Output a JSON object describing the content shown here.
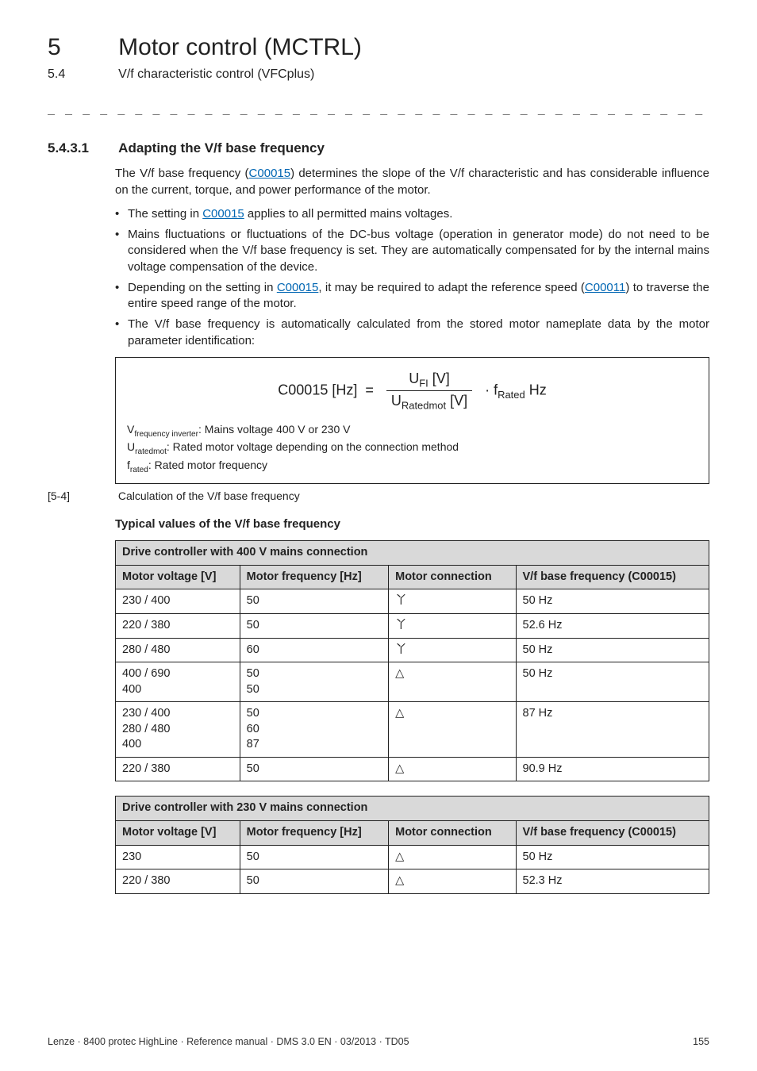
{
  "header": {
    "chapter_num": "5",
    "chapter_title": "Motor control (MCTRL)",
    "section_num": "5.4",
    "section_title": "V/f characteristic control (VFCplus)"
  },
  "dashline": "_ _ _ _ _ _ _ _ _ _ _ _ _ _ _ _ _ _ _ _ _ _ _ _ _ _ _ _ _ _ _ _ _ _ _ _ _ _ _ _ _ _ _ _ _ _ _ _ _ _ _ _ _ _ _ _ _ _ _ _ _ _ _ _",
  "h3": {
    "num": "5.4.3.1",
    "title": "Adapting the V/f base frequency"
  },
  "intro": {
    "pre": "The V/f base frequency (",
    "link1": "C00015",
    "post": ") determines the slope of the V/f characteristic and has considerable influence on the current, torque, and power performance of the motor."
  },
  "bullets": {
    "b1_pre": "The setting in ",
    "b1_link": "C00015",
    "b1_post": " applies to all permitted mains voltages.",
    "b2": "Mains fluctuations or fluctuations of the DC-bus voltage (operation in generator mode) do not need to be considered when the V/f base frequency is set. They are automatically compensated for by the internal mains voltage compensation of the device.",
    "b3_pre": "Depending on the setting in ",
    "b3_link1": "C00015",
    "b3_mid": ", it may be required to adapt the reference speed (",
    "b3_link2": "C00011",
    "b3_post": ") to traverse the entire speed range of the motor.",
    "b4": "The V/f base frequency is automatically calculated from the stored motor nameplate data by the motor parameter identification:"
  },
  "formula": {
    "lhs": "C00015 [Hz]",
    "eq": "=",
    "num_a": "U",
    "num_sub": "FI",
    "num_b": " [V]",
    "den_a": "U",
    "den_sub": "Ratedmot",
    "den_b": " [V]",
    "dot": "·",
    "f": "f",
    "f_sub": "Rated",
    "f_unit": " Hz"
  },
  "legend": {
    "l1_a": "V",
    "l1_sub": "frequency inverter",
    "l1_b": ": Mains voltage 400 V or 230 V",
    "l2_a": "U",
    "l2_sub": "ratedmot",
    "l2_b": ": Rated motor voltage depending on the connection method",
    "l3_a": "f",
    "l3_sub": "rated",
    "l3_b": ": Rated motor frequency"
  },
  "figlabel": {
    "tag": "[5-4]",
    "text": "Calculation of the V/f base frequency"
  },
  "subhead": "Typical values of the V/f base frequency",
  "glyphs": {
    "star": "丫",
    "delta": "△"
  },
  "table400": {
    "caption": "Drive controller with 400 V mains connection",
    "cols": [
      "Motor voltage [V]",
      "Motor frequency [Hz]",
      "Motor connection",
      "V/f base frequency (C00015)"
    ],
    "rows": [
      {
        "mv": "230 / 400",
        "mf": "50",
        "conn": "star",
        "vf": "50 Hz"
      },
      {
        "mv": "220 / 380",
        "mf": "50",
        "conn": "star",
        "vf": "52.6 Hz"
      },
      {
        "mv": "280 / 480",
        "mf": "60",
        "conn": "star",
        "vf": "50 Hz"
      },
      {
        "mv": "400 / 690\n400",
        "mf": "50\n50",
        "conn": "delta",
        "vf": "50 Hz"
      },
      {
        "mv": "230 / 400\n280 / 480\n400",
        "mf": "50\n60\n87",
        "conn": "delta",
        "vf": "87 Hz"
      },
      {
        "mv": "220 / 380",
        "mf": "50",
        "conn": "delta",
        "vf": "90.9 Hz"
      }
    ]
  },
  "table230": {
    "caption": "Drive controller with 230 V mains connection",
    "cols": [
      "Motor voltage [V]",
      "Motor frequency [Hz]",
      "Motor connection",
      "V/f base frequency (C00015)"
    ],
    "rows": [
      {
        "mv": "230",
        "mf": "50",
        "conn": "delta",
        "vf": "50 Hz"
      },
      {
        "mv": "220 / 380",
        "mf": "50",
        "conn": "delta",
        "vf": "52.3 Hz"
      }
    ]
  },
  "footer": {
    "left": "Lenze · 8400 protec HighLine · Reference manual · DMS 3.0 EN · 03/2013 · TD05",
    "right": "155"
  }
}
